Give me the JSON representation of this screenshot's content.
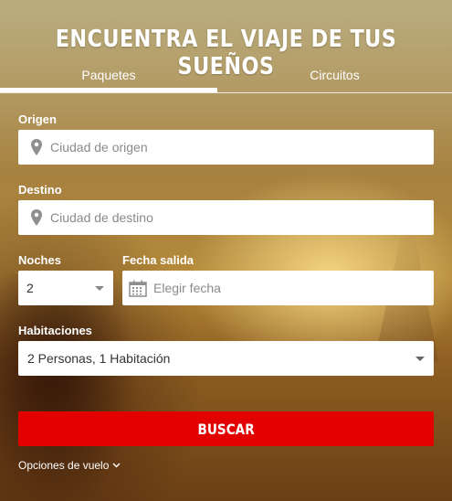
{
  "header": {
    "title": "ENCUENTRA EL VIAJE DE TUS SUEÑOS"
  },
  "tabs": [
    {
      "label": "Paquetes",
      "active": true
    },
    {
      "label": "Circuitos",
      "active": false
    }
  ],
  "form": {
    "origin": {
      "label": "Origen",
      "placeholder": "Ciudad de origen",
      "icon": "map-pin-icon"
    },
    "destination": {
      "label": "Destino",
      "placeholder": "Ciudad de destino",
      "icon": "map-pin-icon"
    },
    "nights": {
      "label": "Noches",
      "value": "2"
    },
    "departure": {
      "label": "Fecha salida",
      "placeholder": "Elegir fecha",
      "icon": "calendar-icon"
    },
    "rooms": {
      "label": "Habitaciones",
      "value": "2 Personas, 1 Habitación"
    },
    "search_label": "BUSCAR",
    "flight_options_label": "Opciones de vuelo"
  },
  "colors": {
    "accent": "#e20000",
    "field_bg": "#ffffff",
    "text": "#ffffff"
  }
}
